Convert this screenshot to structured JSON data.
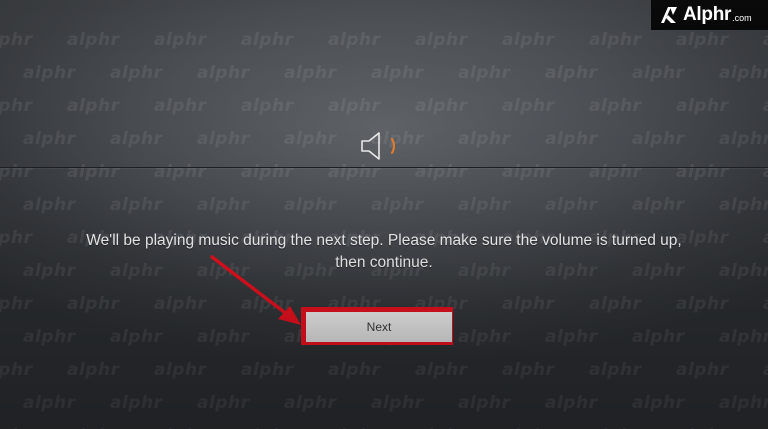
{
  "prompt": {
    "message": "We'll be playing music during the next step. Please make sure the volume is turned up, then continue."
  },
  "actions": {
    "next_label": "Next"
  },
  "icons": {
    "volume": "speaker-icon",
    "annotation": "red-arrow-icon",
    "brand_logo": "alphr-logo-icon"
  },
  "brand": {
    "name": "Alphr",
    "tld": ".com"
  },
  "watermark": {
    "text": "alphr"
  },
  "colors": {
    "highlight": "#e4111f",
    "button_bg": "#e3e3e3",
    "speaker_wave": "#e87a2a",
    "text": "#f2f2f2"
  }
}
